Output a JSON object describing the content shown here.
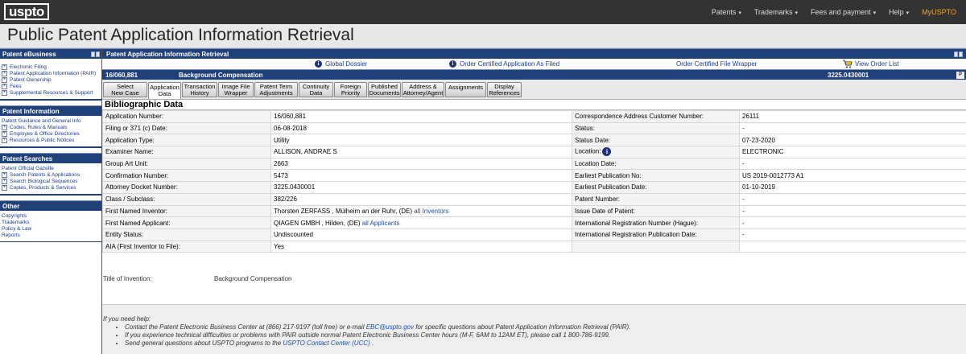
{
  "brand": {
    "logo": "uspto"
  },
  "topnav": {
    "items": [
      {
        "label": "Patents",
        "caret": "▾"
      },
      {
        "label": "Trademarks",
        "caret": "▾"
      },
      {
        "label": "Fees and payment",
        "caret": "▾"
      },
      {
        "label": "Help",
        "caret": "▾"
      }
    ],
    "my": "MyUSPTO",
    "accent": "#f0a33a"
  },
  "page_title": "Public Patent Application Information Retrieval",
  "sidebar": {
    "ebusiness": {
      "title": "Patent eBusiness",
      "items": [
        "Electronic Filing",
        "Patent Application Information (PAIR)",
        "Patent Ownership",
        "Fees",
        "Supplemental Resources & Support"
      ]
    },
    "information": {
      "title": "Patent Information",
      "top": "Patent Guidance and General Info",
      "items": [
        "Codes, Rules & Manuals",
        "Employee & Office Directories",
        "Resources & Public Notices"
      ]
    },
    "searches": {
      "title": "Patent Searches",
      "top": "Patent Official Gazette",
      "items": [
        "Search Patents & Applications",
        "Search Biological Sequences",
        "Copies, Products & Services"
      ]
    },
    "other": {
      "title": "Other",
      "items": [
        "Copyrights",
        "Trademarks",
        "Policy & Law",
        "Reports"
      ]
    }
  },
  "main": {
    "title": "Patent Application Information Retrieval",
    "links": {
      "global_dossier": "Global Dossier",
      "order_certified": "Order Certified Application As Filed",
      "order_wrapper": "Order Certified File Wrapper",
      "view_orders": "View Order List"
    },
    "appbar": {
      "number": "16/060,881",
      "title": "Background Compensation",
      "docket": "3225.0430001"
    },
    "tabs": [
      {
        "l1": "Select",
        "l2": "New Case"
      },
      {
        "l1": "Application",
        "l2": "Data"
      },
      {
        "l1": "Transaction",
        "l2": "History"
      },
      {
        "l1": "Image File",
        "l2": "Wrapper"
      },
      {
        "l1": "Patent Term",
        "l2": "Adjustments"
      },
      {
        "l1": "Continuity",
        "l2": "Data"
      },
      {
        "l1": "Foreign",
        "l2": "Priority"
      },
      {
        "l1": "Published",
        "l2": "Documents"
      },
      {
        "l1": "Address &",
        "l2": "Attorney/Agent"
      },
      {
        "l1": "Assignments",
        "l2": ""
      },
      {
        "l1": "Display",
        "l2": "References"
      }
    ],
    "section_title": "Bibliographic Data",
    "rows": [
      {
        "l1": "Application Number:",
        "v1": "16/060,881",
        "l2": "Correspondence Address Customer Number:",
        "v2": "26111"
      },
      {
        "l1": "Filing or 371 (c) Date:",
        "v1": "06-08-2018",
        "l2": "Status:",
        "v2": "-"
      },
      {
        "l1": "Application Type:",
        "v1": "Utility",
        "l2": "Status Date:",
        "v2": "07-23-2020"
      },
      {
        "l1": "Examiner Name:",
        "v1": "ALLISON, ANDRAE S",
        "l2": "Location:",
        "v2": "ELECTRONIC"
      },
      {
        "l1": "Group Art Unit:",
        "v1": "2663",
        "l2": "Location Date:",
        "v2": "-"
      },
      {
        "l1": "Confirmation Number:",
        "v1": "5473",
        "l2": "Earliest Publication No:",
        "v2": "US 2019-0012773 A1"
      },
      {
        "l1": "Attorney Docket Number:",
        "v1": "3225.0430001",
        "l2": "Earliest Publication Date:",
        "v2": "01-10-2019"
      },
      {
        "l1": "Class / Subclass:",
        "v1": "382/226",
        "l2": "Patent Number:",
        "v2": "-"
      },
      {
        "l1": "First Named Inventor:",
        "v1": "Thorsten ZERFASS , Mülheim an der Ruhr, (DE)",
        "v1link": "all Inventors",
        "l2": "Issue Date of Patent:",
        "v2": "-"
      },
      {
        "l1": "First Named Applicant:",
        "v1": "QIAGEN GMBH , Hilden, (DE)",
        "v1link": "all Applicants",
        "l2": "International Registration Number (Hague):",
        "v2": "-"
      },
      {
        "l1": "Entity Status:",
        "v1": "Undiscounted",
        "l2": "International Registration Publication Date:",
        "v2": "-"
      },
      {
        "l1": "AIA (First Inventor to File):",
        "v1": "Yes",
        "l2": "",
        "v2": ""
      }
    ],
    "title_of_invention": {
      "label": "Title of Invention:",
      "value": "Background Compensation"
    },
    "help": {
      "intro": "If you need help:",
      "l1_pre": "Contact the Patent Electronic Business Center at (866) 217-9197 (toll free) or e-mail ",
      "l1_link": "EBC@uspto.gov",
      "l1_post": " for specific questions about Patent Application Information Retrieval (PAIR).",
      "l2": "If you experience technical difficulties or problems with PAIR outside normal Patent Electronic Business Center hours (M-F, 6AM to 12AM ET), please call 1 800-786-9199.",
      "l3_pre": "Send general questions about USPTO programs to the ",
      "l3_link": "USPTO Contact Center (UCC)",
      "l3_post": " ."
    }
  }
}
